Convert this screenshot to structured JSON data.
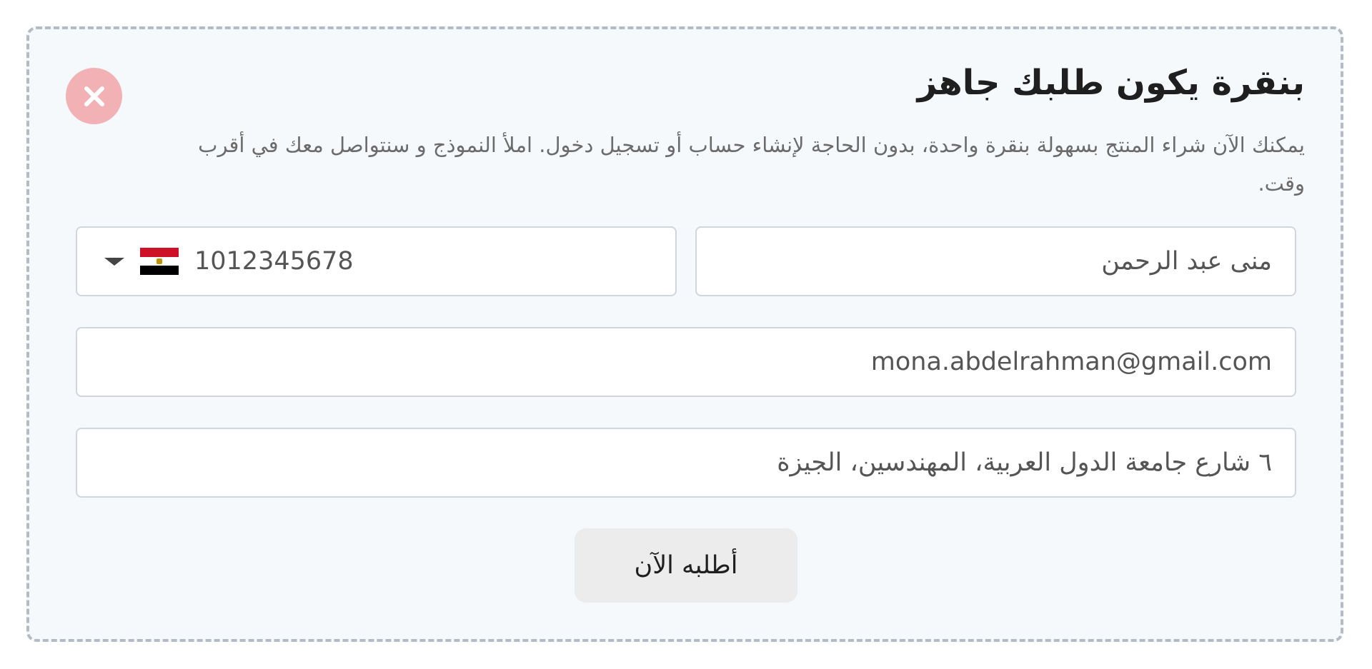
{
  "form": {
    "title": "بنقرة يكون طلبك جاهز",
    "description": "يمكنك الآن شراء المنتج بسهولة بنقرة واحدة، بدون الحاجة لإنشاء حساب أو تسجيل دخول. املأ النموذج و سنتواصل معك في أقرب وقت.",
    "close_icon": "close-icon",
    "fields": {
      "name": {
        "value": "منى عبد الرحمن"
      },
      "phone": {
        "value": "1012345678",
        "country_flag": "egypt-flag-icon",
        "dropdown_icon": "chevron-down-icon"
      },
      "email": {
        "value": "mona.abdelrahman@gmail.com"
      },
      "address": {
        "value": "٦ شارع جامعة الدول العربية، المهندسين، الجيزة"
      }
    },
    "submit_label": "أطلبه الآن"
  },
  "colors": {
    "panel_bg": "#f6f9fc",
    "panel_border": "#b3bcc6",
    "close_bg": "#f2b1b4",
    "button_bg": "#ececec",
    "flag_red": "#ce1126",
    "flag_white": "#ffffff",
    "flag_black": "#000000"
  }
}
